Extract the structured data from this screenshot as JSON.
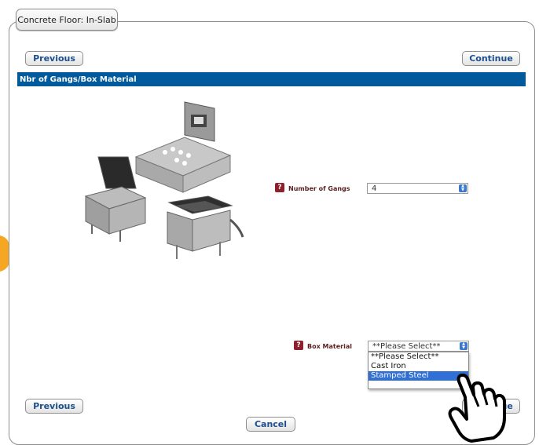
{
  "window": {
    "tab_title": "Concrete Floor: In-Slab"
  },
  "nav": {
    "previous_label": "Previous",
    "continue_label": "Continue",
    "cancel_label": "Cancel"
  },
  "section": {
    "title": "Nbr of Gangs/Box Material"
  },
  "fields": {
    "gangs": {
      "label": "Number of Gangs",
      "value": "4"
    },
    "material": {
      "label": "Box Material",
      "value": "**Please Select**",
      "options": [
        "**Please Select**",
        "Cast Iron",
        "Stamped Steel"
      ],
      "highlighted": "Stamped Steel"
    }
  },
  "help_icon_glyph": "?",
  "colors": {
    "section_bar": "#005a9c",
    "button_text": "#1d4f8c",
    "highlight": "#2f6fd6",
    "help_icon": "#8e1f2d"
  }
}
